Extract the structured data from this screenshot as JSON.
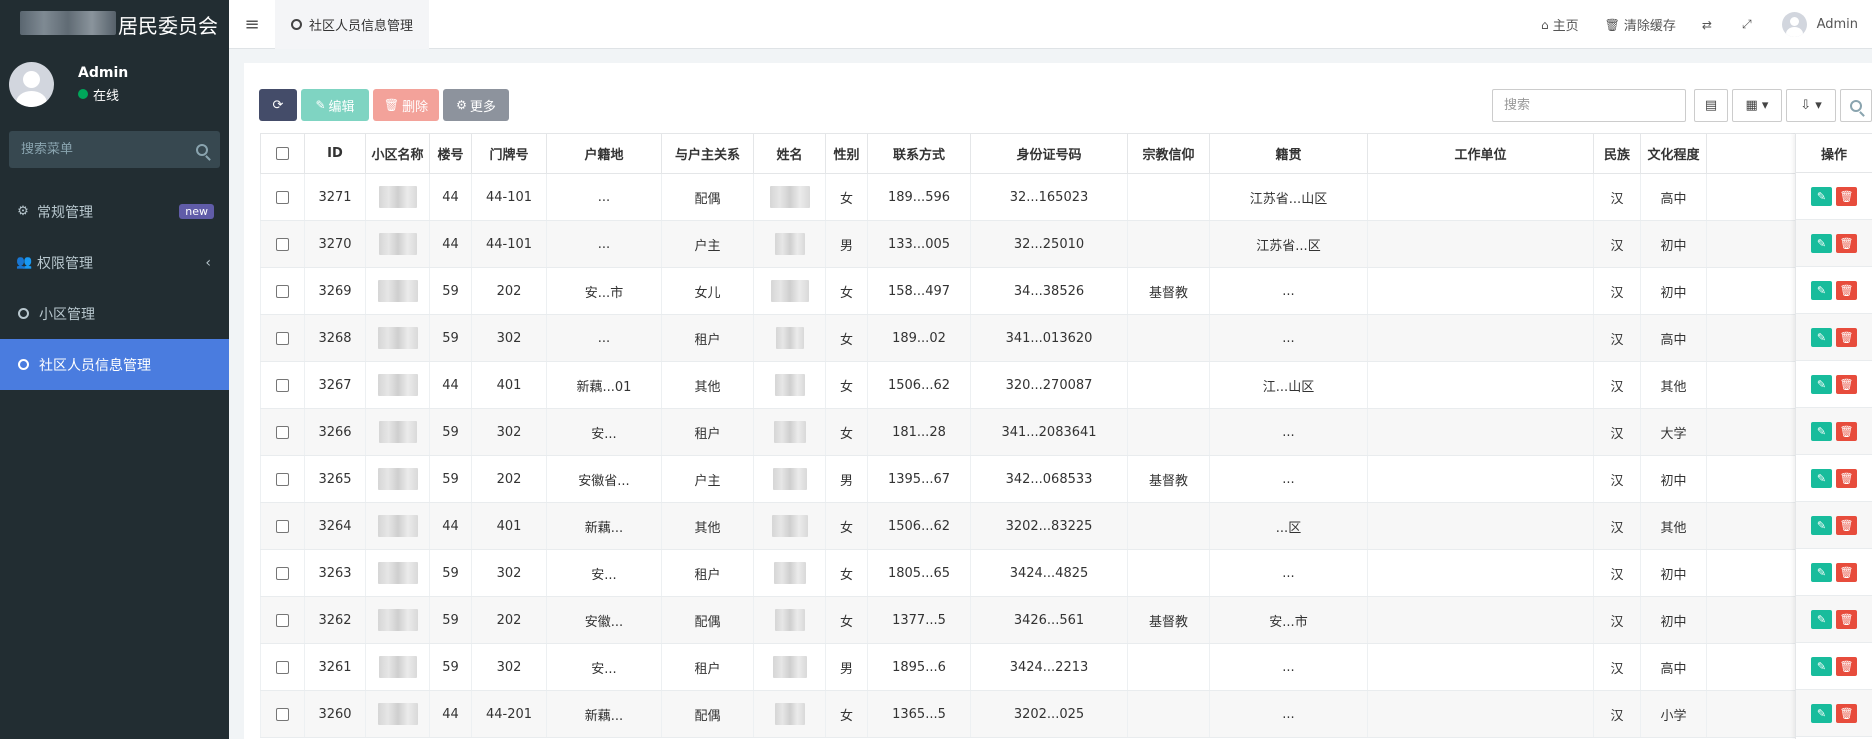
{
  "sidebar": {
    "brand_tail": "居民委员会",
    "user": {
      "name": "Admin",
      "status": "在线"
    },
    "search_placeholder": "搜索菜单",
    "items": [
      {
        "label": "常规管理",
        "badge": "new"
      },
      {
        "label": "权限管理"
      },
      {
        "label": "小区管理"
      },
      {
        "label": "社区人员信息管理"
      }
    ]
  },
  "topbar": {
    "tab_label": "社区人员信息管理",
    "home": "主页",
    "clear_cache": "清除缓存",
    "user": "Admin"
  },
  "toolbar": {
    "edit": "编辑",
    "delete": "删除",
    "more": "更多",
    "search_placeholder": "搜索"
  },
  "table": {
    "headers": [
      "ID",
      "小区名称",
      "楼号",
      "门牌号",
      "户籍地",
      "与户主关系",
      "姓名",
      "性别",
      "联系方式",
      "身份证号码",
      "宗教信仰",
      "籍贯",
      "工作单位",
      "民族",
      "文化程度"
    ],
    "ops_header": "操作",
    "rows": [
      {
        "id": "3271",
        "building": "44",
        "door": "44-101",
        "huji": "...",
        "relation": "配偶",
        "gender": "女",
        "phone": "189...596",
        "idcard": "32...165023",
        "religion": "",
        "jiguan": "江苏省...山区",
        "ethnic": "汉",
        "edu": "高中"
      },
      {
        "id": "3270",
        "building": "44",
        "door": "44-101",
        "huji": "...",
        "relation": "户主",
        "gender": "男",
        "phone": "133...005",
        "idcard": "32...25010",
        "religion": "",
        "jiguan": "江苏省...区",
        "ethnic": "汉",
        "edu": "初中"
      },
      {
        "id": "3269",
        "building": "59",
        "door": "202",
        "huji": "安...市",
        "relation": "女儿",
        "gender": "女",
        "phone": "158...497",
        "idcard": "34...38526",
        "religion": "基督教",
        "jiguan": "...",
        "ethnic": "汉",
        "edu": "初中"
      },
      {
        "id": "3268",
        "building": "59",
        "door": "302",
        "huji": "...",
        "relation": "租户",
        "gender": "女",
        "phone": "189...02",
        "idcard": "341...013620",
        "religion": "",
        "jiguan": "...",
        "ethnic": "汉",
        "edu": "高中"
      },
      {
        "id": "3267",
        "building": "44",
        "door": "401",
        "huji": "新藕...01",
        "relation": "其他",
        "gender": "女",
        "phone": "1506...62",
        "idcard": "320...270087",
        "religion": "",
        "jiguan": "江...山区",
        "ethnic": "汉",
        "edu": "其他"
      },
      {
        "id": "3266",
        "building": "59",
        "door": "302",
        "huji": "安...",
        "relation": "租户",
        "gender": "女",
        "phone": "181...28",
        "idcard": "341...2083641",
        "religion": "",
        "jiguan": "...",
        "ethnic": "汉",
        "edu": "大学"
      },
      {
        "id": "3265",
        "building": "59",
        "door": "202",
        "huji": "安徽省...",
        "relation": "户主",
        "gender": "男",
        "phone": "1395...67",
        "idcard": "342...068533",
        "religion": "基督教",
        "jiguan": "...",
        "ethnic": "汉",
        "edu": "初中"
      },
      {
        "id": "3264",
        "building": "44",
        "door": "401",
        "huji": "新藕...",
        "relation": "其他",
        "gender": "女",
        "phone": "1506...62",
        "idcard": "3202...83225",
        "religion": "",
        "jiguan": "...区",
        "ethnic": "汉",
        "edu": "其他"
      },
      {
        "id": "3263",
        "building": "59",
        "door": "302",
        "huji": "安...",
        "relation": "租户",
        "gender": "女",
        "phone": "1805...65",
        "idcard": "3424...4825",
        "religion": "",
        "jiguan": "...",
        "ethnic": "汉",
        "edu": "初中"
      },
      {
        "id": "3262",
        "building": "59",
        "door": "202",
        "huji": "安徽...",
        "relation": "配偶",
        "gender": "女",
        "phone": "1377...5",
        "idcard": "3426...561",
        "religion": "基督教",
        "jiguan": "安...市",
        "ethnic": "汉",
        "edu": "初中"
      },
      {
        "id": "3261",
        "building": "59",
        "door": "302",
        "huji": "安...",
        "relation": "租户",
        "gender": "男",
        "phone": "1895...6",
        "idcard": "3424...2213",
        "religion": "",
        "jiguan": "...",
        "ethnic": "汉",
        "edu": "高中"
      },
      {
        "id": "3260",
        "building": "44",
        "door": "44-201",
        "huji": "新藕...",
        "relation": "配偶",
        "gender": "女",
        "phone": "1365...5",
        "idcard": "3202...025",
        "religion": "",
        "jiguan": "...",
        "ethnic": "汉",
        "edu": "小学"
      }
    ]
  }
}
